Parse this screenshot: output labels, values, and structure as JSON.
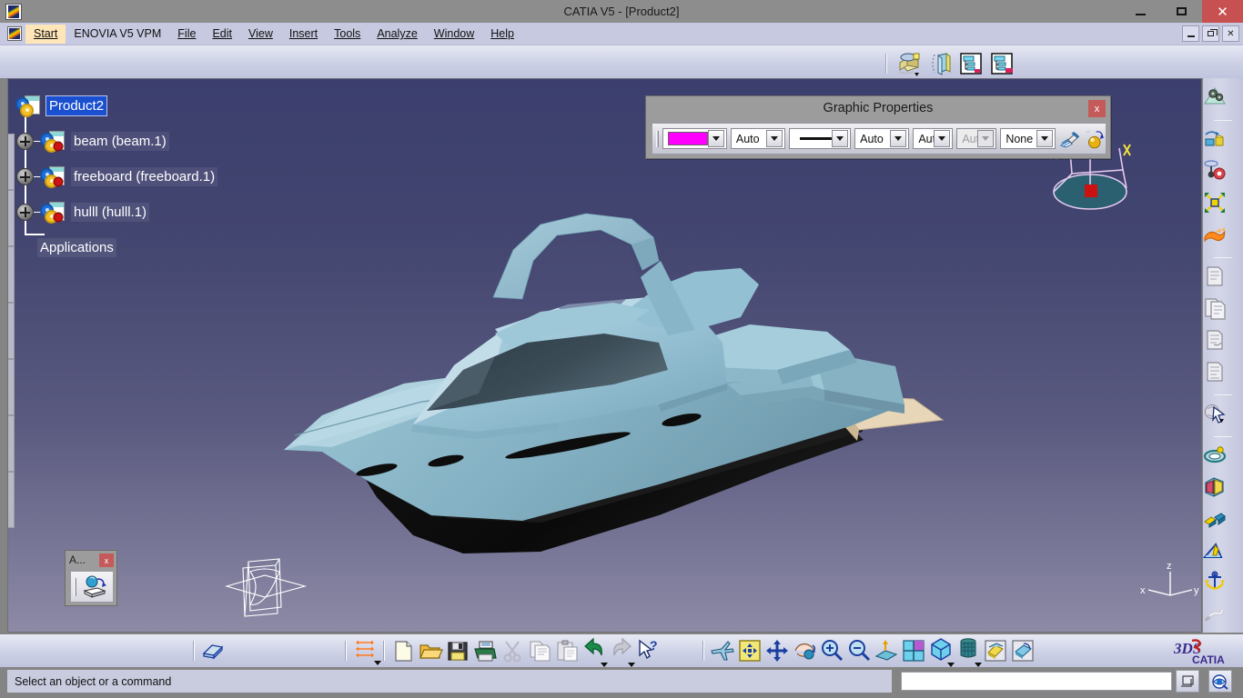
{
  "window": {
    "title": "CATIA V5 - [Product2]",
    "app_icon": "catia-logo-icon",
    "minimize": "–",
    "maximize": "□",
    "close": "✕"
  },
  "menubar": {
    "items": [
      {
        "label": "Start",
        "accel": "S",
        "highlighted": true
      },
      {
        "label": "ENOVIA V5 VPM",
        "accel": ""
      },
      {
        "label": "File",
        "accel": "F"
      },
      {
        "label": "Edit",
        "accel": "E"
      },
      {
        "label": "View",
        "accel": "V"
      },
      {
        "label": "Insert",
        "accel": "I"
      },
      {
        "label": "Tools",
        "accel": "T"
      },
      {
        "label": "Analyze",
        "accel": "A"
      },
      {
        "label": "Window",
        "accel": "W"
      },
      {
        "label": "Help",
        "accel": "H"
      }
    ],
    "mdi_buttons": [
      "minimize-document",
      "restore-document",
      "close-document"
    ]
  },
  "top_toolbar": {
    "icons": [
      {
        "name": "product-structure-tools-icon",
        "has_dropdown": true
      },
      {
        "name": "manage-representations-icon",
        "has_dropdown": false
      },
      {
        "name": "generate-numbering-icon",
        "has_dropdown": false
      },
      {
        "name": "selective-load-icon",
        "has_dropdown": false
      }
    ]
  },
  "spec_tree": {
    "nodes": [
      {
        "label": "Product2",
        "expandable": false,
        "selected": true,
        "depth": 0,
        "icon": "product-node-icon"
      },
      {
        "label": "beam (beam.1)",
        "expandable": true,
        "selected": false,
        "depth": 1,
        "icon": "part-node-icon"
      },
      {
        "label": "freeboard (freeboard.1)",
        "expandable": true,
        "selected": false,
        "depth": 1,
        "icon": "part-node-icon"
      },
      {
        "label": "hulll (hulll.1)",
        "expandable": true,
        "selected": false,
        "depth": 1,
        "icon": "part-node-icon"
      },
      {
        "label": "Applications",
        "expandable": false,
        "selected": false,
        "depth": 1,
        "icon": "none"
      }
    ]
  },
  "graphic_properties": {
    "title": "Graphic Properties",
    "close_label": "x",
    "fields": [
      {
        "name": "fill-color",
        "type": "color",
        "value": "#ff00ff",
        "enabled": true
      },
      {
        "name": "transparency",
        "type": "combo",
        "value": "Auto",
        "enabled": true
      },
      {
        "name": "line-type",
        "type": "line",
        "value": "solid",
        "enabled": true
      },
      {
        "name": "line-weight",
        "type": "combo",
        "value": "Auto",
        "enabled": true
      },
      {
        "name": "point-symbol",
        "type": "combo",
        "value": "Aut",
        "enabled": true
      },
      {
        "name": "layer",
        "type": "combo",
        "value": "Aut",
        "enabled": false
      },
      {
        "name": "rendering-style",
        "type": "combo",
        "value": "None",
        "enabled": true
      }
    ],
    "tool_icons": [
      {
        "name": "painter-brush-icon"
      },
      {
        "name": "apply-material-icon"
      }
    ]
  },
  "viewport": {
    "model_name": "yacht-3d-model",
    "compass_label": "catia-compass",
    "axis": {
      "x": "x",
      "y": "y",
      "z": "z"
    },
    "background_top": "#3c3f6e",
    "background_bottom": "#8d8aa6",
    "hull_color": "#88b5c9",
    "keel_color": "#0c0c0c",
    "deck_tan_color": "#e6d3b3"
  },
  "mini_toolbar": {
    "title": "A...",
    "close_label": "x",
    "icon": "apply-material-icon"
  },
  "right_toolbar": {
    "groups": [
      {
        "icons": [
          {
            "name": "update-all-icon",
            "dropdown": false
          }
        ]
      },
      {
        "icons": [
          {
            "name": "fit-all-in-icon",
            "dropdown": false
          },
          {
            "name": "manipulation-icon",
            "dropdown": true
          },
          {
            "name": "snap-icon",
            "dropdown": false
          },
          {
            "name": "flexible-rigid-icon",
            "dropdown": false
          }
        ]
      },
      {
        "icons": [
          {
            "name": "existing-component-icon",
            "dropdown": false
          },
          {
            "name": "existing-component-with-positioning-icon",
            "dropdown": false
          },
          {
            "name": "replace-component-icon",
            "dropdown": false
          },
          {
            "name": "graph-tree-reordering-icon",
            "dropdown": false
          }
        ]
      },
      {
        "icons": [
          {
            "name": "selection-pointer-icon",
            "dropdown": true
          }
        ]
      },
      {
        "icons": [
          {
            "name": "coincidence-constraint-icon",
            "dropdown": false
          },
          {
            "name": "contact-constraint-icon",
            "dropdown": false
          },
          {
            "name": "offset-constraint-icon",
            "dropdown": false
          },
          {
            "name": "angle-constraint-icon",
            "dropdown": false
          },
          {
            "name": "fix-component-icon",
            "dropdown": false
          },
          {
            "name": "fix-together-icon",
            "dropdown": false
          },
          {
            "name": "quick-constraint-icon",
            "dropdown": false
          }
        ]
      }
    ]
  },
  "bottom_toolbar": {
    "icons": [
      {
        "name": "scene-browser-icon",
        "dropdown": false
      },
      {
        "name": "constraints-creation-icon",
        "dropdown": true
      },
      {
        "name": "new-icon",
        "dropdown": false
      },
      {
        "name": "open-icon",
        "dropdown": false
      },
      {
        "name": "save-icon",
        "dropdown": false
      },
      {
        "name": "print-icon",
        "dropdown": false
      },
      {
        "name": "cut-icon",
        "dropdown": false
      },
      {
        "name": "copy-icon",
        "dropdown": false
      },
      {
        "name": "paste-icon",
        "dropdown": false
      },
      {
        "name": "undo-icon",
        "dropdown": true
      },
      {
        "name": "redo-icon",
        "dropdown": true
      },
      {
        "name": "whats-this-icon",
        "dropdown": false
      },
      {
        "name": "fly-mode-icon",
        "dropdown": false
      },
      {
        "name": "fit-all-in-icon",
        "dropdown": false
      },
      {
        "name": "pan-icon",
        "dropdown": false
      },
      {
        "name": "rotate-icon",
        "dropdown": false
      },
      {
        "name": "zoom-in-icon",
        "dropdown": false
      },
      {
        "name": "zoom-out-icon",
        "dropdown": false
      },
      {
        "name": "normal-view-icon",
        "dropdown": false
      },
      {
        "name": "multi-view-icon",
        "dropdown": false
      },
      {
        "name": "isometric-view-icon",
        "dropdown": true
      },
      {
        "name": "shading-with-edges-icon",
        "dropdown": true
      },
      {
        "name": "hide-show-icon",
        "dropdown": false
      },
      {
        "name": "swap-visible-space-icon",
        "dropdown": false
      }
    ],
    "brand": "CATIA",
    "brand_mark": "3DS"
  },
  "statusbar": {
    "message": "Select an object or a command",
    "command_input_value": "",
    "buttons": [
      {
        "name": "power-input-icon"
      },
      {
        "name": "quick-info-icon"
      }
    ]
  }
}
